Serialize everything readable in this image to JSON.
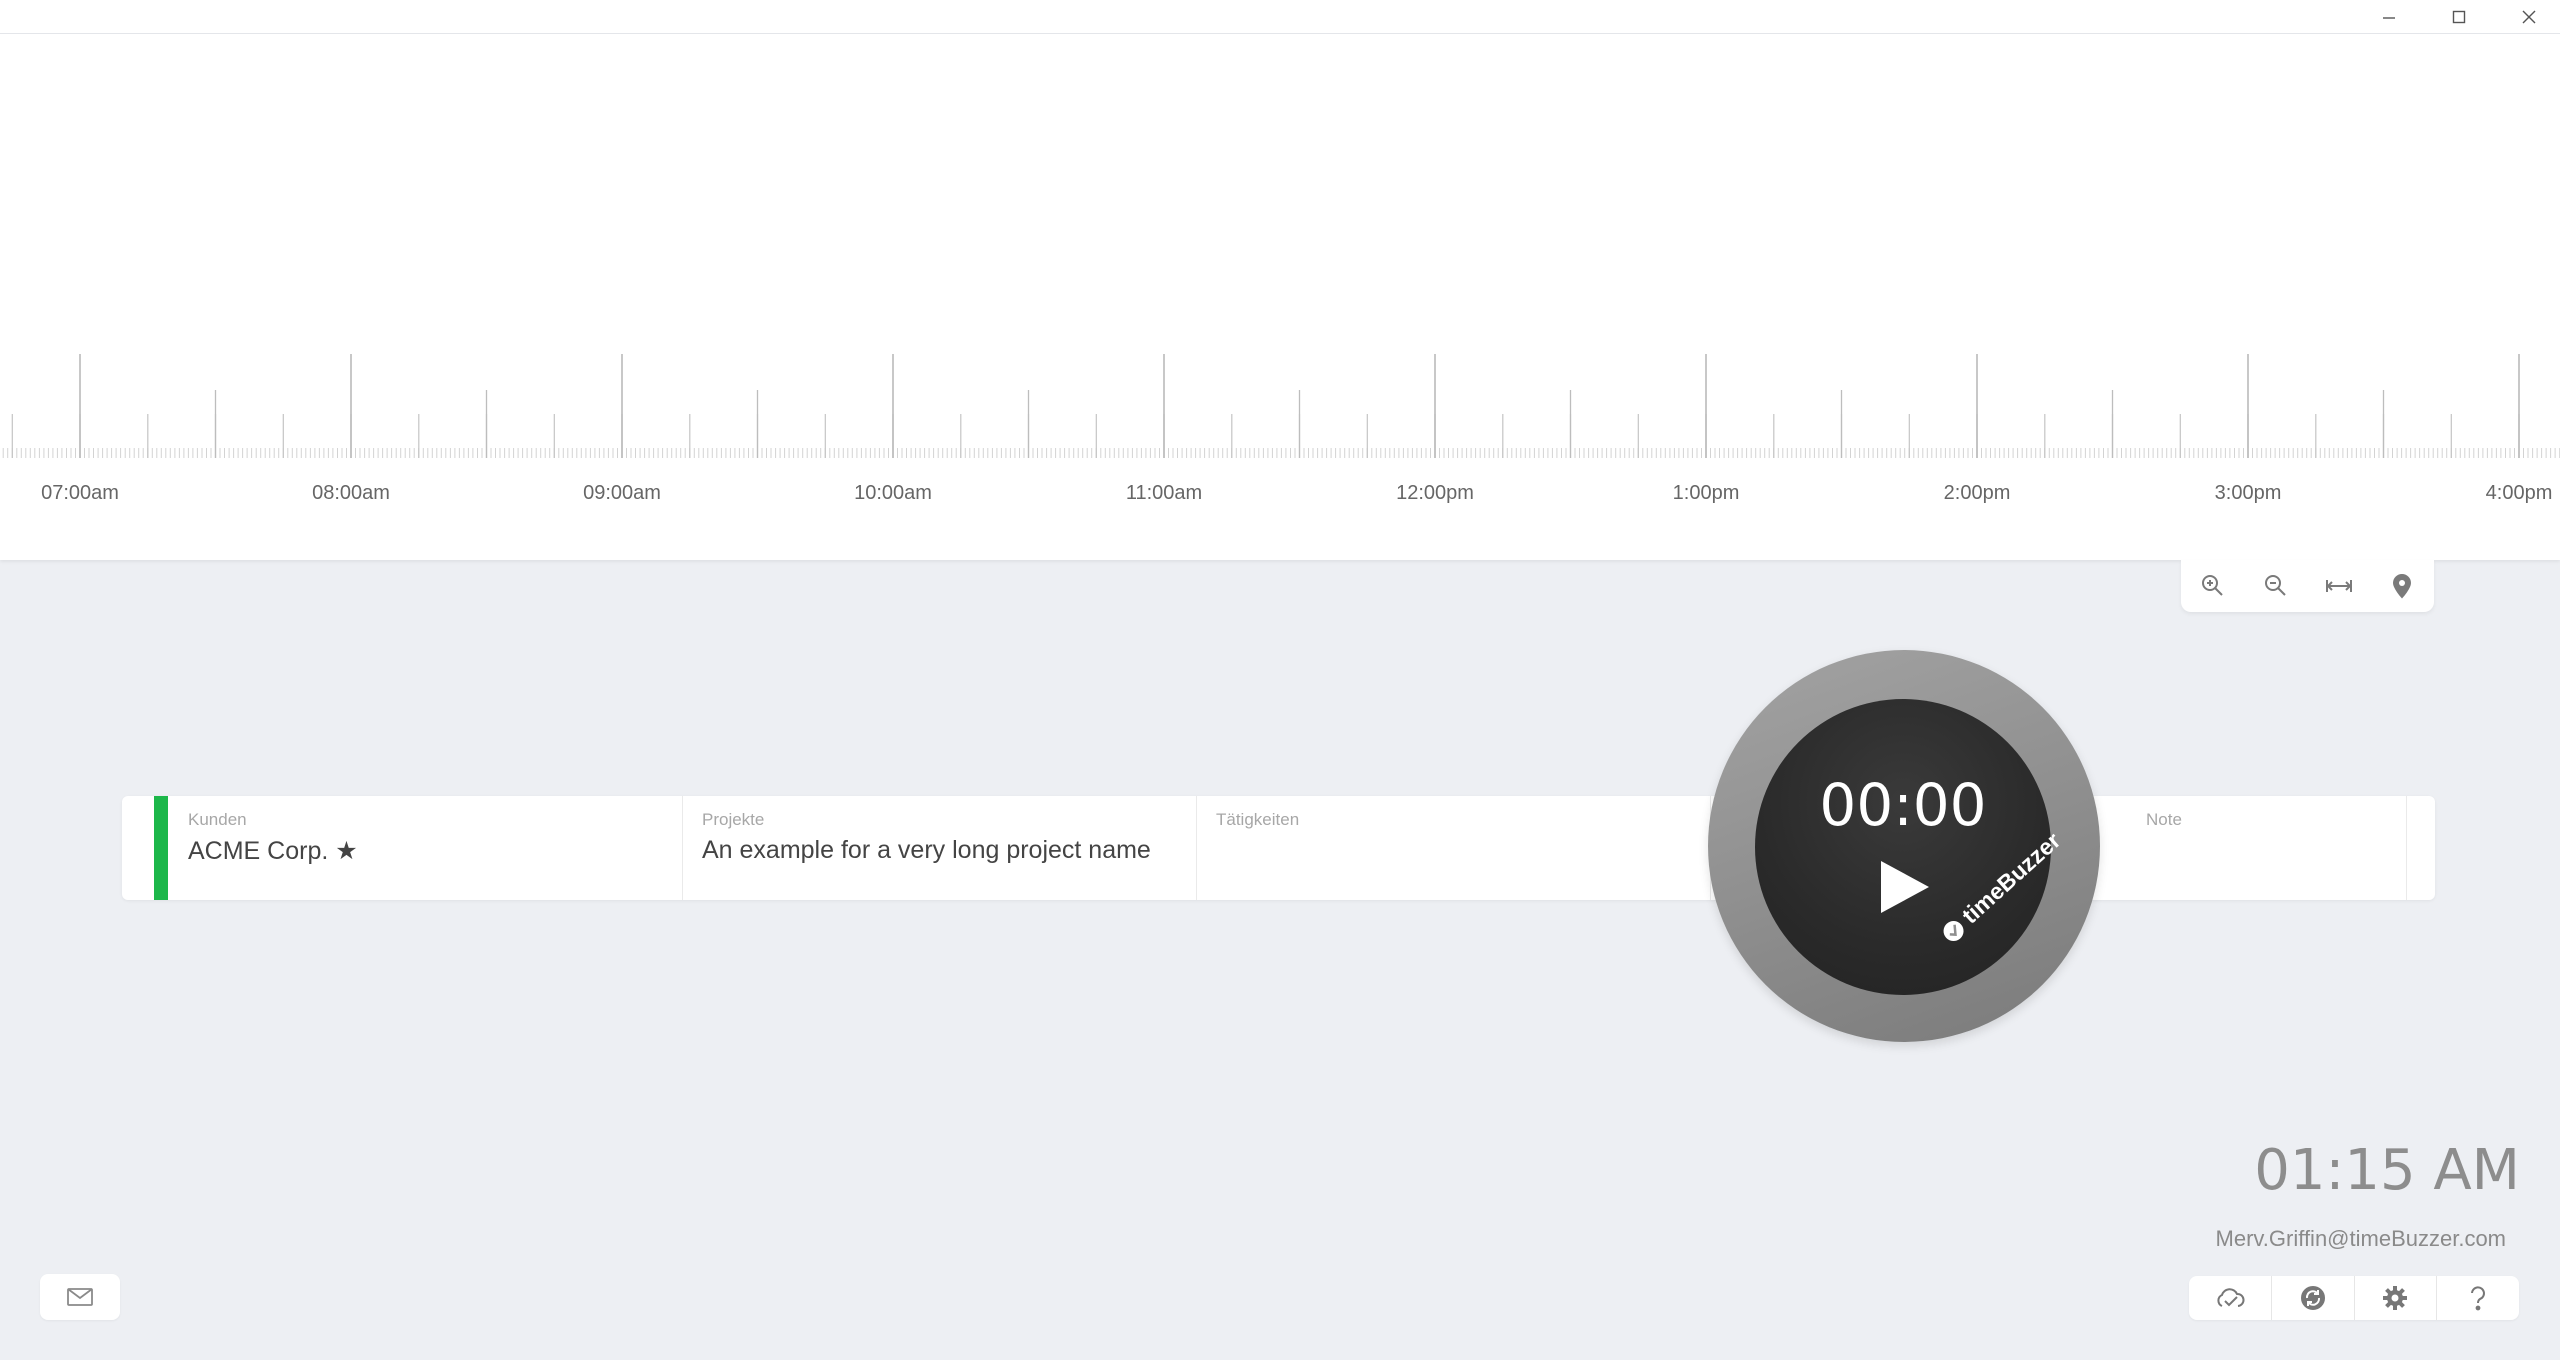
{
  "timeline": {
    "tick_labels": [
      "07:00am",
      "08:00am",
      "09:00am",
      "10:00am",
      "11:00am",
      "12:00pm",
      "1:00pm",
      "2:00pm",
      "3:00pm",
      "4:00pm"
    ]
  },
  "entry": {
    "client_label": "Kunden",
    "client_value": "ACME Corp. ★",
    "project_label": "Projekte",
    "project_value": "An example for a very long project name",
    "activity_label": "Tätigkeiten",
    "activity_value": "",
    "note_label": "Note",
    "note_value": "",
    "color": "#1db74a"
  },
  "buzzer": {
    "time": "00:00",
    "brand": "timeBuzzer"
  },
  "status": {
    "clock": "01:15 AM",
    "email": "Merv.Griffin@timeBuzzer.com"
  }
}
